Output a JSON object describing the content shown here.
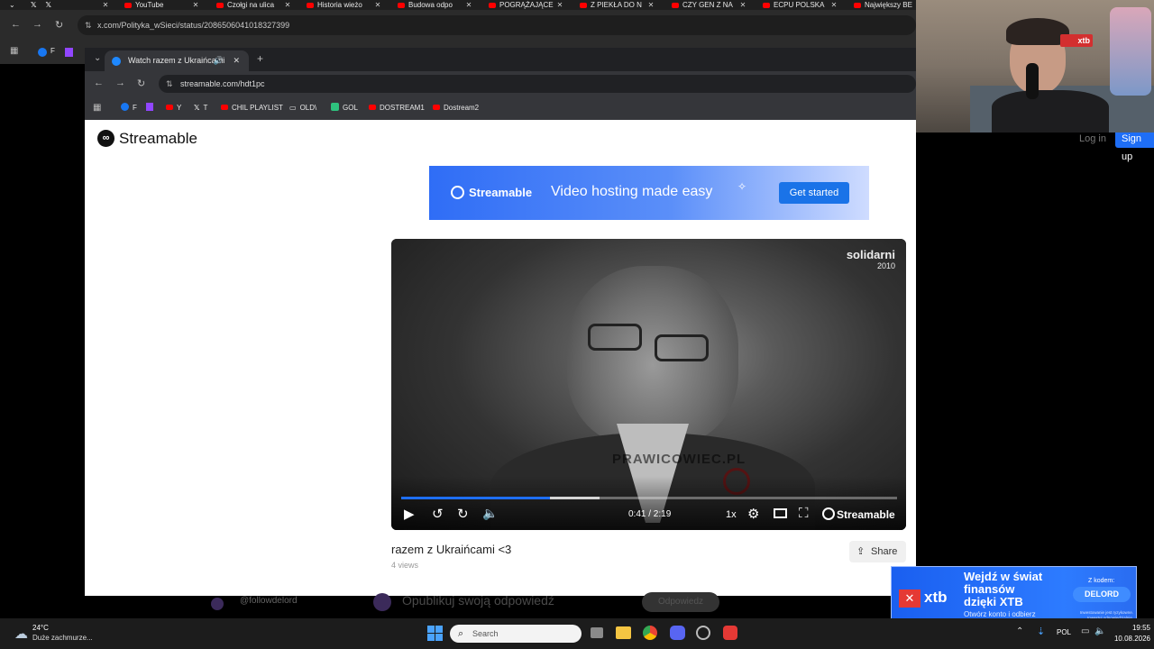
{
  "outer_browser": {
    "tabs": [
      {
        "label": "",
        "kind": "x"
      },
      {
        "label": "YouTube",
        "kind": "yt"
      },
      {
        "label": "Czołgi na ulica",
        "kind": "yt"
      },
      {
        "label": "Historia wieżo",
        "kind": "yt"
      },
      {
        "label": "Budowa odpo",
        "kind": "yt"
      },
      {
        "label": "POGRĄŻAJĄCE",
        "kind": "yt"
      },
      {
        "label": "Z PIEKŁA DO N",
        "kind": "yt"
      },
      {
        "label": "CZY GEN Z NA",
        "kind": "yt"
      },
      {
        "label": "ECPU POLSKA",
        "kind": "yt"
      },
      {
        "label": "Największy BE",
        "kind": "yt"
      }
    ],
    "url": "x.com/Polityka_wSieci/status/2086506041018327399",
    "bookmarks": [
      "F"
    ]
  },
  "inner_browser": {
    "tab_title": "Watch razem z Ukraińcami",
    "url": "streamable.com/hdt1pc",
    "bookmarks": [
      "F",
      "Y",
      "T",
      "CHIL PLAYLIST",
      "OLD\\",
      "GOL",
      "DOSTREAM1",
      "Dostream2"
    ]
  },
  "streamable": {
    "logo": "Streamable",
    "login": "Log in",
    "signup": "Sign up",
    "banner": {
      "brand": "Streamable",
      "headline": "Video hosting made easy",
      "cta": "Get started"
    },
    "player": {
      "watermark_line1": "solidarni",
      "watermark_line2": "2010",
      "overlay_text": "PRAWICOWIEC.PL",
      "time": "0:41 / 2:19",
      "speed": "1x",
      "brand": "Streamable",
      "progress": 0.3,
      "buffered": 0.4
    },
    "video_title": "razem z Ukraińcami <3",
    "views": "4 views",
    "share": "Share"
  },
  "background_page": {
    "handle": "@followdelord",
    "reply_placeholder": "Opublikuj swoją odpowiedź",
    "reply_button": "Odpowiedz"
  },
  "xtb_ad": {
    "logo": "xtb",
    "headline": "Wejdź w świat finansów dzięki XTB",
    "subtext": "Otwórz konto i odbierz bezpłatny kurs",
    "code_label": "Z kodem:",
    "code": "DELORD",
    "disclaimer": "Inwestowanie jest ryzykowne. Inwestuj odpowiedzialnie."
  },
  "webcam_overlay": {
    "logo": "xtb"
  },
  "taskbar": {
    "weather_temp": "24°C",
    "weather_desc": "Duże zachmurze...",
    "search": "Search",
    "language": "POL",
    "time": "19:55",
    "date": "10.08.2026"
  }
}
